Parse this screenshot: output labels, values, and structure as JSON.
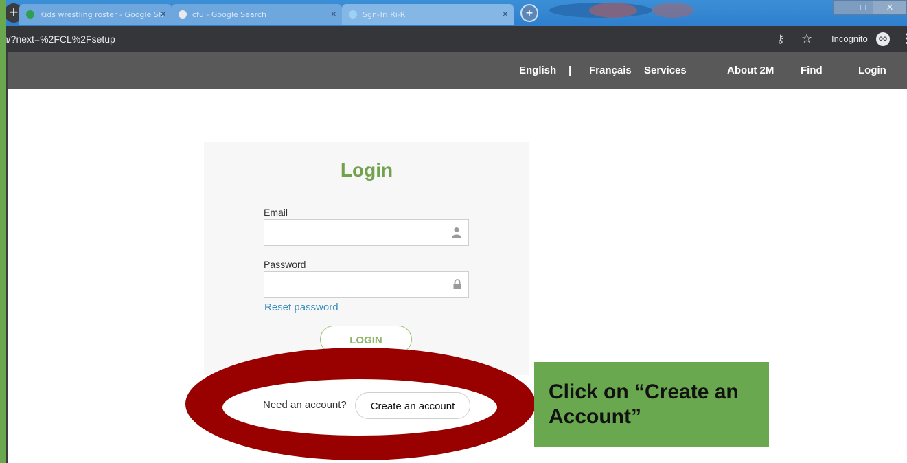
{
  "browser": {
    "tabs": [
      {
        "label": "Kids wrestling roster - Google Sh"
      },
      {
        "label": "cfu - Google Search"
      },
      {
        "label": "Sgn-Tri Ri-R"
      }
    ],
    "url": "n/?next=%2FCL%2Fsetup",
    "incognito_label": "Incognito"
  },
  "site_nav": {
    "items": [
      {
        "label": "English"
      },
      {
        "label": "|"
      },
      {
        "label": "Français"
      },
      {
        "label": "Services"
      },
      {
        "label": "About 2M"
      },
      {
        "label": "Find"
      },
      {
        "label": "Login"
      }
    ]
  },
  "login": {
    "title": "Login",
    "email_label": "Email",
    "email_value": "",
    "password_label": "Password",
    "password_value": "",
    "reset_link": "Reset password",
    "login_button": "LOGIN",
    "need_account": "Need an account?",
    "create_account": "Create an account"
  },
  "annotation": {
    "callout_text": "Click on “Create an Account”",
    "callout_color": "#6aa84f",
    "ring_color": "#990000"
  },
  "colors": {
    "accent_green": "#73a24e",
    "link_blue": "#3c8dbc",
    "nav_bg": "#595959"
  }
}
